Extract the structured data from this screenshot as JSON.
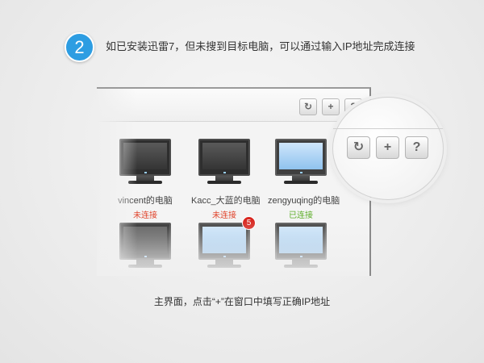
{
  "step": {
    "number": "2",
    "text": "如已安装迅雷7，但未搜到目标电脑，可以通过输入IP地址完成连接"
  },
  "toolbar": {
    "refresh_icon": "↻",
    "add_icon": "+",
    "help_icon": "?"
  },
  "devices": [
    {
      "name": "vincent的电脑",
      "status": "未连接",
      "screen": "off"
    },
    {
      "name": "Kacc_大蓝的电脑",
      "status": "未连接",
      "screen": "off"
    },
    {
      "name": "zengyuqing的电脑",
      "status": "已连接",
      "screen": "on"
    },
    {
      "screen": "off"
    },
    {
      "screen": "on",
      "badge": "5"
    },
    {
      "screen": "on"
    }
  ],
  "caption": "主界面，点击“+”在窗口中填写正确IP地址",
  "colors": {
    "accent": "#2d9de2",
    "status_disconnected": "#e0442b",
    "status_connected": "#5eae2a",
    "badge": "#d8261f"
  }
}
